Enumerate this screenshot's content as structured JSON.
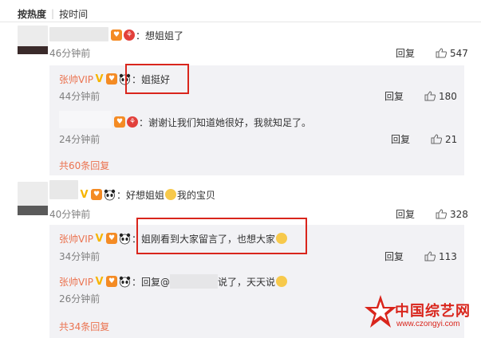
{
  "sort": {
    "hot_label": "按热度",
    "time_label": "按时间"
  },
  "comments": [
    {
      "text": "：想姐姐了",
      "time": "46分钟前",
      "reply_label": "回复",
      "likes": "547",
      "replies": [
        {
          "user": "张帅VIP",
          "text": "：姐挺好",
          "time": "44分钟前",
          "reply_label": "回复",
          "likes": "180"
        },
        {
          "user": "",
          "text": "：谢谢让我们知道她很好，我就知足了。",
          "time": "24分钟前",
          "reply_label": "回复",
          "likes": "21"
        }
      ],
      "more": "共60条回复"
    },
    {
      "text_a": "：好想姐姐",
      "text_b": "我的宝贝",
      "time": "40分钟前",
      "reply_label": "回复",
      "likes": "328",
      "replies": [
        {
          "user": "张帅VIP",
          "text": "：姐刚看到大家留言了，也想大家",
          "time": "34分钟前",
          "reply_label": "回复",
          "likes": "113"
        },
        {
          "user": "张帅VIP",
          "text_a": "：回复@",
          "text_b": "说了，天天说",
          "time": "26分钟前",
          "reply_label": "回复",
          "likes": ""
        }
      ],
      "more": "共34条回复"
    }
  ],
  "watermark": {
    "title": "中国综艺网",
    "url": "www.czongyi.com"
  },
  "colors": {
    "username": "#eb7350",
    "highlight_box": "#d9251c",
    "reply_bg": "#f2f2f5"
  }
}
